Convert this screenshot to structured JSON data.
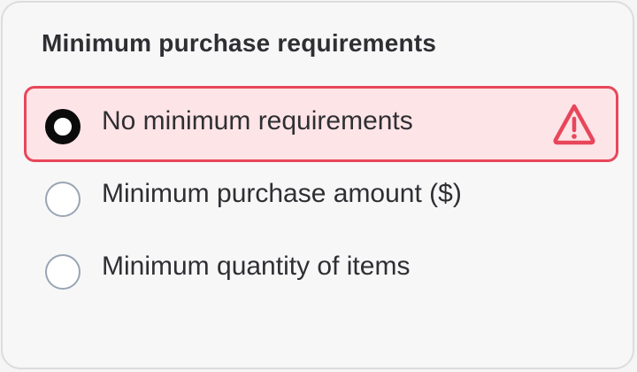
{
  "title": "Minimum purchase requirements",
  "options": [
    {
      "label": "No minimum requirements",
      "selected": true,
      "state": "error",
      "icon": "warning-icon"
    },
    {
      "label": "Minimum purchase amount ($)",
      "selected": false
    },
    {
      "label": "Minimum quantity of items",
      "selected": false
    }
  ],
  "colors": {
    "error_border": "#e8465a",
    "error_background": "#fde4e7",
    "text": "#2f2f33",
    "radio_border": "#9aa5b4"
  }
}
